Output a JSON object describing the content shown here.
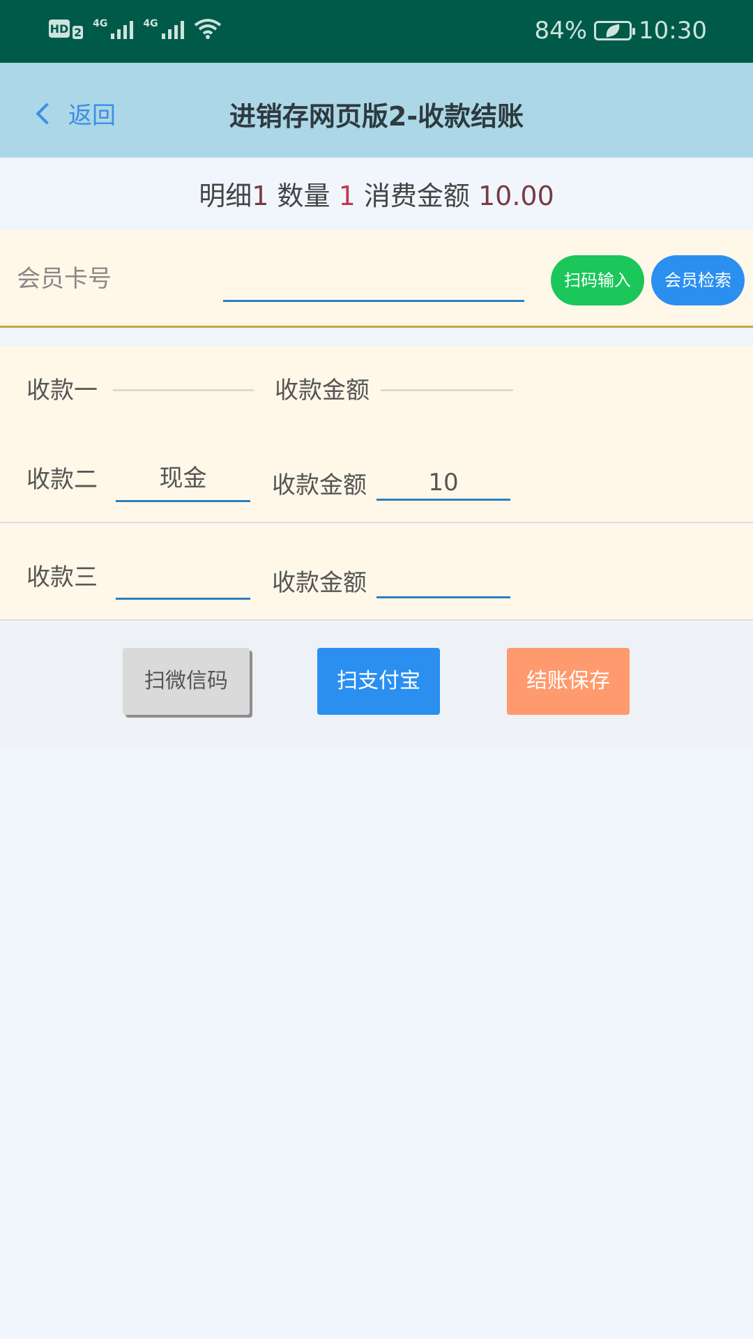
{
  "status_bar": {
    "hd": "HD",
    "sim": "2",
    "net1": "4G",
    "net2": "4G",
    "battery": "84%",
    "time": "10:30"
  },
  "header": {
    "back_label": "返回",
    "title": "进销存网页版2-收款结账"
  },
  "summary": {
    "detail_label": "明细",
    "detail_value": "1",
    "qty_label": "数量",
    "qty_value": "1",
    "amount_label": "消费金额",
    "amount_value": "10.00"
  },
  "member": {
    "label": "会员卡号",
    "value": "",
    "scan_button": "扫码输入",
    "search_button": "会员检索"
  },
  "payments": [
    {
      "label": "收款一",
      "method": "",
      "amount_label": "收款金额",
      "amount": ""
    },
    {
      "label": "收款二",
      "method": "现金",
      "amount_label": "收款金额",
      "amount": "10"
    },
    {
      "label": "收款三",
      "method": "",
      "amount_label": "收款金额",
      "amount": ""
    }
  ],
  "actions": {
    "wechat": "扫微信码",
    "alipay": "扫支付宝",
    "save": "结账保存"
  }
}
